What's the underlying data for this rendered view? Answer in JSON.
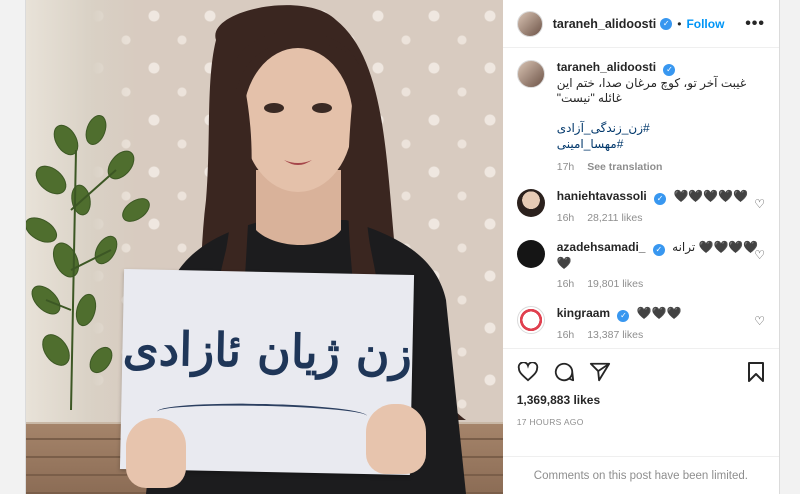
{
  "post": {
    "username": "taraneh_alidoosti",
    "separator": "•",
    "follow_label": "Follow",
    "more_label": "•••",
    "caption": {
      "text": "غیبت آخر تو، کوچ مرغان صدا، ختم این غائله \"نیست\"",
      "hashtag1": "#زن_زندگی_آزادی",
      "hashtag2": "#مهسا_امینی",
      "time": "17h",
      "see_translation": "See translation"
    },
    "comments": [
      {
        "username": "haniehtavassoli",
        "text": "🖤🖤🖤🖤🖤",
        "time": "16h",
        "likes": "28,211 likes"
      },
      {
        "username": "azadehsamadi_",
        "text": "ترانه 🖤🖤🖤🖤🖤",
        "time": "16h",
        "likes": "19,801 likes"
      },
      {
        "username": "kingraam",
        "text": "🖤🖤🖤",
        "time": "16h",
        "likes": "13,387 likes"
      }
    ],
    "likes_count": "1,369,883 likes",
    "time_ago": "17 HOURS AGO",
    "limited_notice": "Comments on this post have been limited."
  },
  "sign": {
    "text": "زن ژیان ئازادی"
  },
  "colors": {
    "link_blue": "#0095f6",
    "verified_blue": "#3897f0",
    "muted": "#8e8e8e",
    "hashtag": "#00376b",
    "sign_ink": "#1f3658"
  },
  "icons": [
    "verified-icon",
    "heart-icon",
    "comment-icon",
    "share-icon",
    "bookmark-icon",
    "more-icon"
  ]
}
